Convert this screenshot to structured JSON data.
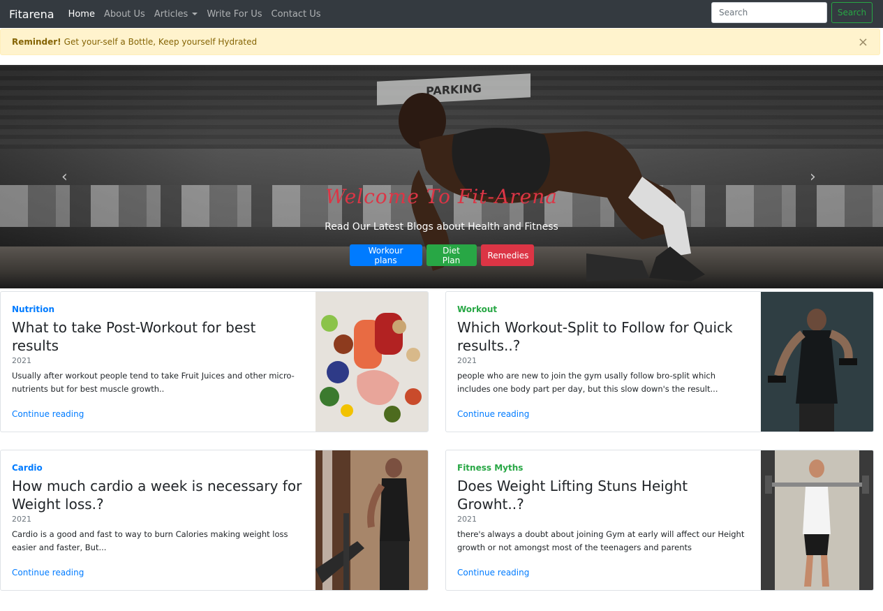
{
  "navbar": {
    "brand": "Fitarena",
    "links": [
      "Home",
      "About Us",
      "Articles",
      "Write For Us",
      "Contact Us"
    ],
    "search_placeholder": "Search",
    "search_button": "Search"
  },
  "alert": {
    "label": "Reminder!",
    "message": "Get your-self a Bottle, Keep yourself Hydrated",
    "close": "×"
  },
  "carousel": {
    "sign": "PARKING",
    "title": "Welcome To Fit-Arena",
    "subtitle": "Read Our Latest Blogs about Health and Fitness",
    "prev": "‹",
    "next": "›",
    "buttons": [
      "Workour plans",
      "Diet Plan",
      "Remedies"
    ]
  },
  "cards": [
    {
      "category": "Nutrition",
      "title": "What to take Post-Workout for best results",
      "year": "2021",
      "excerpt": "Usually after workout people tend to take Fruit Juices and other micro-nutrients but for best muscle growth..",
      "link": "Continue reading",
      "icon": "food-image"
    },
    {
      "category": "Workout",
      "title": "Which Workout-Split to Follow for Quick results..?",
      "year": "2021",
      "excerpt": "people who are new to join the gym usally follow bro-split which includes one body part per day, but this slow down's the result...",
      "link": "Continue reading",
      "icon": "dumbbell-curl-image"
    },
    {
      "category": "Cardio",
      "title": "How much cardio a week is necessary for Weight loss.?",
      "year": "2021",
      "excerpt": "Cardio is a good and fast to way to burn Calories making weight loss easier and faster, But...",
      "link": "Continue reading",
      "icon": "treadmill-image"
    },
    {
      "category": "Fitness Myths",
      "title": "Does Weight Lifting Stuns Height Growht..?",
      "year": "2021",
      "excerpt": "there's always a doubt about joining Gym at early will affect our Height growth or not amongst most of the teenagers and parents",
      "link": "Continue reading",
      "icon": "barbell-squat-image"
    }
  ],
  "colors": {
    "navbar": "#343a40",
    "primary": "#007bff",
    "success": "#28a745",
    "danger": "#dc3545",
    "alert_bg": "#fff3cd"
  }
}
